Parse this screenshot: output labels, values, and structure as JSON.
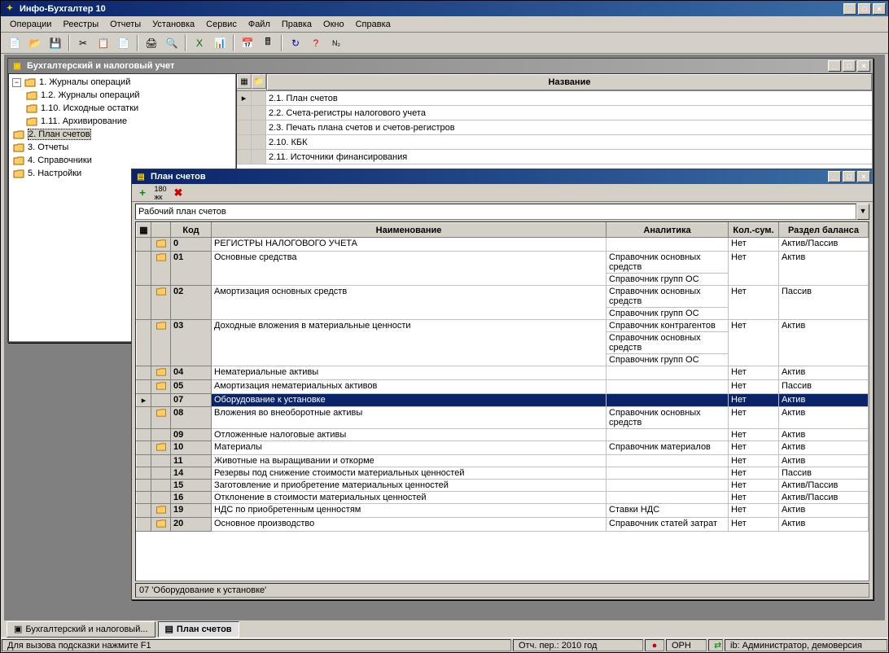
{
  "app_title": "Инфо-Бухгалтер 10",
  "menu": [
    "Операции",
    "Реестры",
    "Отчеты",
    "Установка",
    "Сервис",
    "Файл",
    "Правка",
    "Окно",
    "Справка"
  ],
  "child1": {
    "title": "Бухгалтерский и налоговый учет",
    "tree": {
      "root": "1. Журналы операций",
      "children": [
        "1.2. Журналы операций",
        "1.10. Исходные остатки",
        "1.11. Архивирование"
      ],
      "siblings": [
        "2. План счетов",
        "3. Отчеты",
        "4. Справочники",
        "5. Настройки"
      ]
    },
    "grid_header": "Название",
    "grid_rows": [
      "2.1. План счетов",
      "2.2. Счета-регистры налогового учета",
      "2.3. Печать плана счетов и счетов-регистров",
      "2.10. КБК",
      "2.11. Источники финансирования"
    ]
  },
  "child2": {
    "title": "План счетов",
    "combo": "Рабочий план счетов",
    "columns": [
      "Код",
      "Наименование",
      "Аналитика",
      "Кол.-сум.",
      "Раздел баланса"
    ],
    "rows": [
      {
        "code": "0",
        "name": "РЕГИСТРЫ НАЛОГОВОГО УЧЕТА",
        "anal": [
          ""
        ],
        "kol": "Нет",
        "bal": "Актив/Пассив",
        "folder": true
      },
      {
        "code": "01",
        "name": "Основные средства",
        "anal": [
          "Справочник основных средств",
          "Справочник групп ОС"
        ],
        "kol": "Нет",
        "bal": "Актив",
        "folder": true
      },
      {
        "code": "02",
        "name": "Амортизация основных средств",
        "anal": [
          "Справочник основных средств",
          "Справочник групп ОС"
        ],
        "kol": "Нет",
        "bal": "Пассив",
        "folder": true
      },
      {
        "code": "03",
        "name": "Доходные вложения в материальные ценности",
        "anal": [
          "Справочник контрагентов",
          "Справочник основных средств",
          "Справочник групп ОС"
        ],
        "kol": "Нет",
        "bal": "Актив",
        "folder": true
      },
      {
        "code": "04",
        "name": "Нематериальные активы",
        "anal": [
          ""
        ],
        "kol": "Нет",
        "bal": "Актив",
        "folder": true
      },
      {
        "code": "05",
        "name": "Амортизация нематериальных активов",
        "anal": [
          ""
        ],
        "kol": "Нет",
        "bal": "Пассив",
        "folder": true
      },
      {
        "code": "07",
        "name": "Оборудование к установке",
        "anal": [
          ""
        ],
        "kol": "Нет",
        "bal": "Актив",
        "selected": true
      },
      {
        "code": "08",
        "name": "Вложения во внеоборотные активы",
        "anal": [
          "Справочник основных средств"
        ],
        "kol": "Нет",
        "bal": "Актив",
        "folder": true
      },
      {
        "code": "09",
        "name": "Отложенные налоговые активы",
        "anal": [
          ""
        ],
        "kol": "Нет",
        "bal": "Актив"
      },
      {
        "code": "10",
        "name": "Материалы",
        "anal": [
          "Справочник материалов"
        ],
        "kol": "Нет",
        "bal": "Актив",
        "folder": true
      },
      {
        "code": "11",
        "name": "Животные на выращивании и откорме",
        "anal": [
          ""
        ],
        "kol": "Нет",
        "bal": "Актив"
      },
      {
        "code": "14",
        "name": "Резервы под снижение стоимости материальных ценностей",
        "anal": [
          ""
        ],
        "kol": "Нет",
        "bal": "Пассив"
      },
      {
        "code": "15",
        "name": "Заготовление и приобретение материальных ценностей",
        "anal": [
          ""
        ],
        "kol": "Нет",
        "bal": "Актив/Пассив"
      },
      {
        "code": "16",
        "name": "Отклонение в стоимости материальных ценностей",
        "anal": [
          ""
        ],
        "kol": "Нет",
        "bal": "Актив/Пассив"
      },
      {
        "code": "19",
        "name": "НДС по приобретенным ценностям",
        "anal": [
          "Ставки НДС"
        ],
        "kol": "Нет",
        "bal": "Актив",
        "folder": true
      },
      {
        "code": "20",
        "name": "Основное производство",
        "anal": [
          "Справочник статей затрат"
        ],
        "kol": "Нет",
        "bal": "Актив",
        "folder": true
      }
    ],
    "status": "07 'Оборудование к установке'"
  },
  "taskbar": {
    "btn1": "Бухгалтерский и налоговый...",
    "btn2": "План счетов"
  },
  "statusbar": {
    "hint": "Для вызова подсказки нажмите F1",
    "period": "Отч. пер.:  2010 год",
    "orn": "ОРН",
    "user": "ib: Администратор, демоверсия"
  }
}
